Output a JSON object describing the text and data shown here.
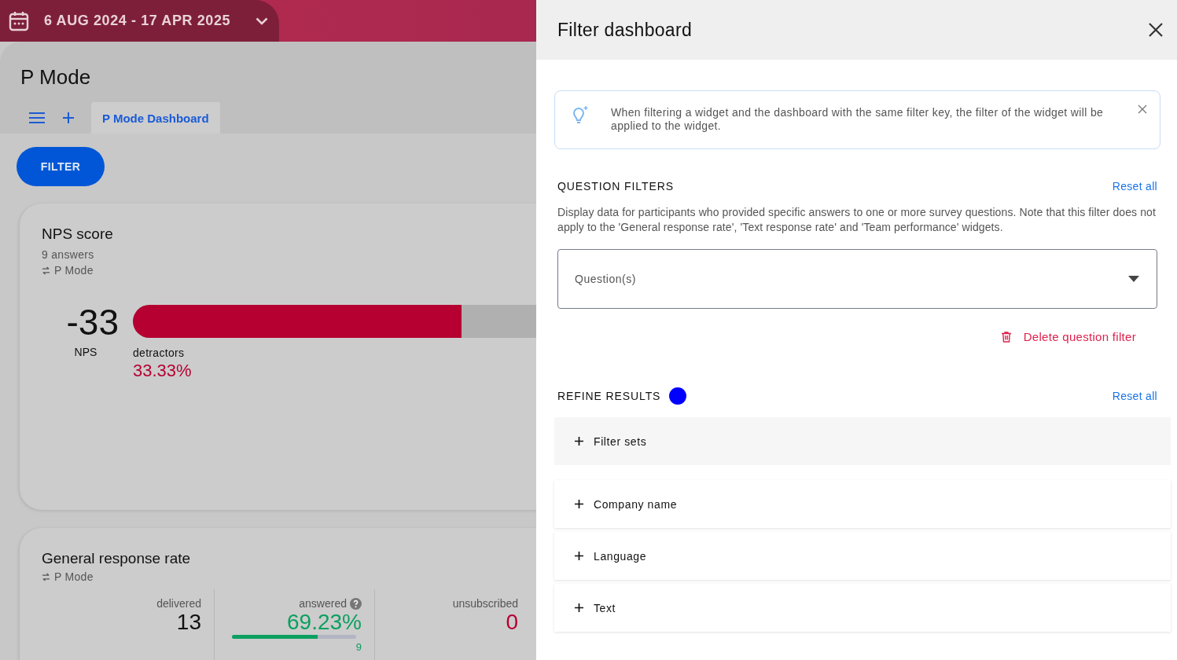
{
  "date_range": {
    "label": "6 AUG 2024 - 17 APR 2025"
  },
  "page": {
    "title": "P Mode"
  },
  "tabs": [
    {
      "label": "P Mode Dashboard",
      "selected": true
    }
  ],
  "filter_button": "FILTER",
  "nps_card": {
    "title": "NPS score",
    "answers": "9 answers",
    "source": "P Mode",
    "score": "-33",
    "score_label": "NPS",
    "level": 0.3333,
    "segment_label": "detractors",
    "segment_value": "33.33%"
  },
  "response_card": {
    "title": "General response rate",
    "source": "P Mode",
    "stats": [
      {
        "kind": "plain",
        "label": "delivered",
        "value": "13"
      },
      {
        "kind": "progress",
        "label": "answered",
        "value": "69.23%",
        "level": 0.69,
        "count": "9"
      },
      {
        "kind": "alert",
        "label": "unsubscribed",
        "value": "0"
      }
    ]
  },
  "drawer": {
    "title": "Filter dashboard",
    "notice": "When filtering a widget and the dashboard with the same filter key, the filter of the widget will be applied to the widget.",
    "question_filters": {
      "heading": "QUESTION FILTERS",
      "reset": "Reset all",
      "description": "Display data for participants who provided specific answers to one or more survey questions. Note that this filter does not apply to the 'General response rate', 'Text response rate' and 'Team performance' widgets.",
      "select_placeholder": "Question(s)",
      "delete": "Delete question filter"
    },
    "refine_results": {
      "heading": "REFINE RESULTS",
      "reset": "Reset all",
      "items": [
        {
          "kind": "group",
          "label": "Filter sets"
        },
        {
          "kind": "field",
          "label": "Company name"
        },
        {
          "kind": "field",
          "label": "Language"
        },
        {
          "kind": "field",
          "label": "Text"
        }
      ]
    }
  }
}
